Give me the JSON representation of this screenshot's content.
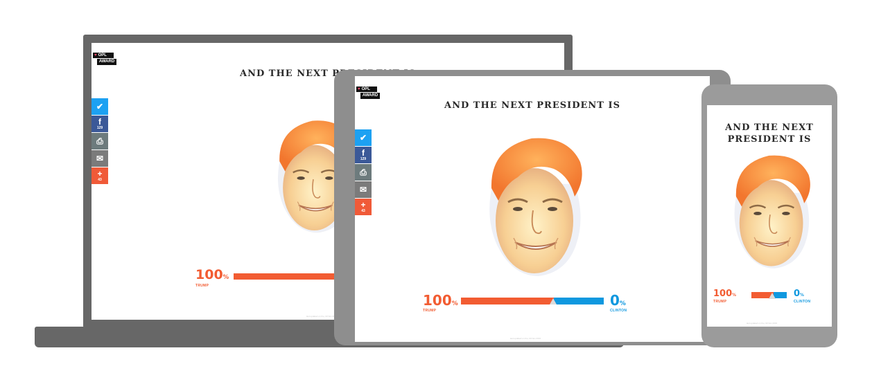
{
  "headline": "AND THE NEXT PRESIDENT IS",
  "headline_truncated": "AND THE NEXT PRESIDENT IS",
  "headline_phone_line1": "AND THE NEXT",
  "headline_phone_line2": "PRESIDENT IS",
  "logo": {
    "line1": "OPL",
    "line2": "AWARD"
  },
  "share": {
    "twitter_icon": "twitter-icon",
    "facebook_count": "129",
    "print_icon": "print-icon",
    "email_icon": "email-icon",
    "plus_count": "43"
  },
  "result": {
    "left_value": "100",
    "left_unit": "%",
    "left_name": "TRUMP",
    "right_value": "0",
    "right_unit": "%",
    "right_name": "CLINTON",
    "left_share_fraction": 1.0
  },
  "footer": "last updated on thu, 03 Nov 2016",
  "colors": {
    "trump": "#f25c32",
    "clinton": "#0f98df",
    "bezel_laptop": "#676767",
    "bezel_tablet": "#8e8e8e",
    "bezel_phone": "#9b9b9b"
  }
}
